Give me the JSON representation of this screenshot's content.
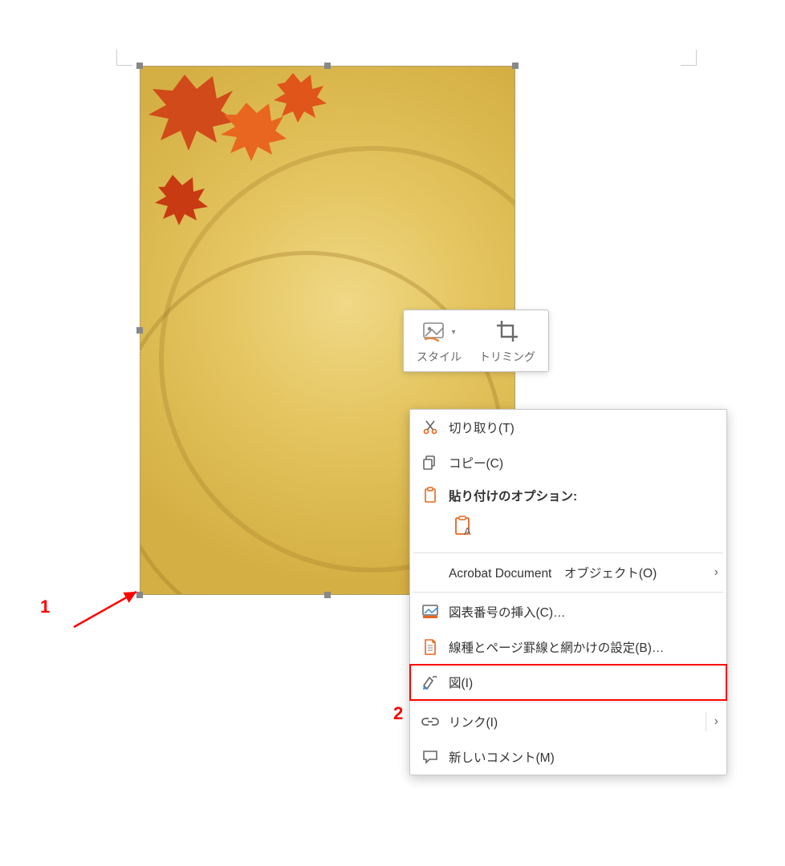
{
  "annotations": {
    "one": "1",
    "two": "2"
  },
  "mini_toolbar": {
    "style_label": "スタイル",
    "trim_label": "トリミング"
  },
  "context_menu": {
    "cut": "切り取り(T)",
    "copy": "コピー(C)",
    "paste_header": "貼り付けのオプション:",
    "acrobat_object": "Acrobat Document　オブジェクト(O)",
    "insert_caption": "図表番号の挿入(C)…",
    "borders": "線種とページ罫線と網かけの設定(B)…",
    "picture": "図(I)",
    "link": "リンク(I)",
    "new_comment": "新しいコメント(M)"
  },
  "icons": {
    "scissors": "cut-icon",
    "copy": "copy-icon",
    "clipboard": "clipboard-icon",
    "paste_text": "paste-text-icon",
    "image_caption": "image-caption-icon",
    "page": "page-icon",
    "bucket": "format-picture-icon",
    "link": "link-icon",
    "comment": "comment-icon",
    "style": "picture-style-icon",
    "crop": "crop-icon",
    "chevron": "chevron-right-icon"
  }
}
